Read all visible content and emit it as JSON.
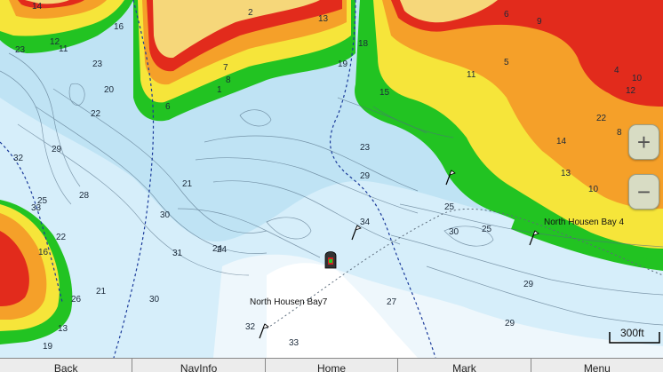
{
  "map": {
    "scale_label": "300ft",
    "waypoints": [
      {
        "label": "North Housen Bay 4"
      },
      {
        "label": "North Housen Bay7"
      }
    ],
    "depth_labels": [
      "14",
      "16",
      "12",
      "11",
      "23",
      "18",
      "13",
      "19",
      "15",
      "7",
      "1",
      "2",
      "8",
      "6",
      "23",
      "20",
      "22",
      "32",
      "29",
      "21",
      "30",
      "28",
      "25",
      "33",
      "22",
      "24",
      "16",
      "31",
      "30",
      "26",
      "21",
      "32",
      "29",
      "33",
      "25",
      "6",
      "5",
      "4",
      "10",
      "12",
      "11",
      "9",
      "14",
      "13",
      "10",
      "8",
      "22",
      "30",
      "23",
      "29",
      "34",
      "27",
      "19",
      "13",
      "25",
      "24",
      "29"
    ]
  },
  "zoom": {
    "in_label": "+",
    "out_label": "−"
  },
  "softkeys": [
    "Back",
    "NavInfo",
    "Home",
    "Mark",
    "Menu"
  ],
  "colors": {
    "shore": "#f6d77a",
    "red": "#e22b1c",
    "orange": "#f5a029",
    "yellow": "#f6e53a",
    "green": "#22c322",
    "shallow_water": "#bfe3f4",
    "deep_water": "#e8f4fb"
  }
}
